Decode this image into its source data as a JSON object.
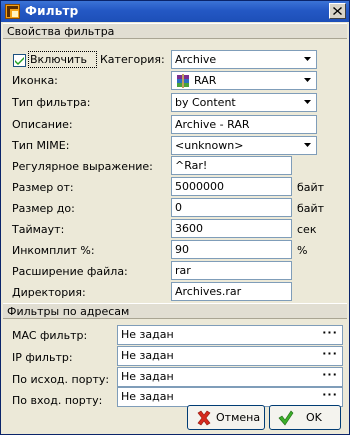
{
  "window": {
    "title": "Фильтр",
    "close_glyph": "×"
  },
  "sections": {
    "properties": "Свойства фильтра",
    "address": "Фильтры по адресам"
  },
  "enable": {
    "label": "Включить",
    "checked": true
  },
  "category": {
    "label": "Категория:",
    "value": "Archive"
  },
  "icon_field": {
    "label": "Иконка:",
    "value": "RAR"
  },
  "filter_type": {
    "label": "Тип фильтра:",
    "value": "by Content"
  },
  "description": {
    "label": "Описание:",
    "value": "Archive - RAR"
  },
  "mime_type": {
    "label": "Тип MIME:",
    "value": "<unknown>"
  },
  "regex": {
    "label": "Регулярное выражение:",
    "value": "^Rar!"
  },
  "size_from": {
    "label": "Размер от:",
    "value": "5000000",
    "unit": "байт"
  },
  "size_to": {
    "label": "Размер до:",
    "value": "0",
    "unit": "байт"
  },
  "timeout": {
    "label": "Таймаут:",
    "value": "3600",
    "unit": "сек"
  },
  "incomplete": {
    "label": "Инкомплит %:",
    "value": "90",
    "unit": "%"
  },
  "extension": {
    "label": "Расширение файла:",
    "value": "rar"
  },
  "directory": {
    "label": "Директория:",
    "value": "Archives.rar"
  },
  "mac_filter": {
    "label": "MAC фильтр:",
    "value": "Не задан"
  },
  "ip_filter": {
    "label": "IP фильтр:",
    "value": "Не задан"
  },
  "src_port": {
    "label": "По исход. порту:",
    "value": "Не задан"
  },
  "dst_port": {
    "label": "По вход. порту:",
    "value": "Не задан"
  },
  "ellipsis": "···",
  "buttons": {
    "cancel": "Отмена",
    "ok": "OK"
  },
  "colors": {
    "accent": "#2458c4",
    "checkmark": "#21a121",
    "cancel_icon": "#d62b1f",
    "ok_icon": "#3cae2a"
  },
  "icons": {
    "window": "app-icon",
    "close": "close-icon",
    "rar": "rar-archive-icon",
    "cancel": "cross-icon",
    "ok": "checkmark-icon"
  }
}
